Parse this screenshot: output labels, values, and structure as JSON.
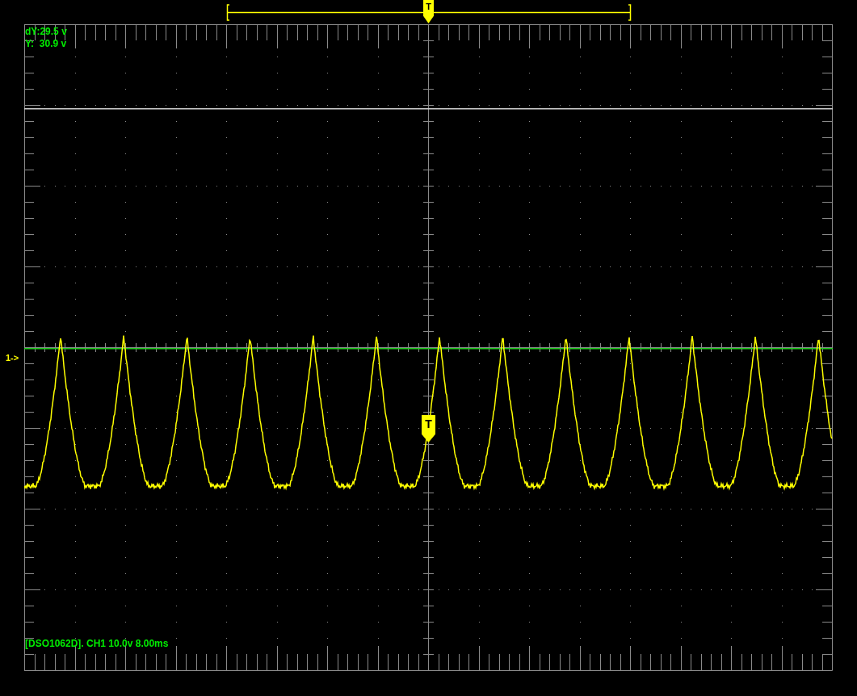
{
  "readouts": [
    {
      "text": "dY:29.5 v"
    },
    {
      "text": "Y:  30.9 v"
    }
  ],
  "top_trigger_marker": "T",
  "channel_marker": "1->",
  "trigger_marker": "T",
  "status": "[DSO1062D]. CH1 10.0v 8.00ms"
}
